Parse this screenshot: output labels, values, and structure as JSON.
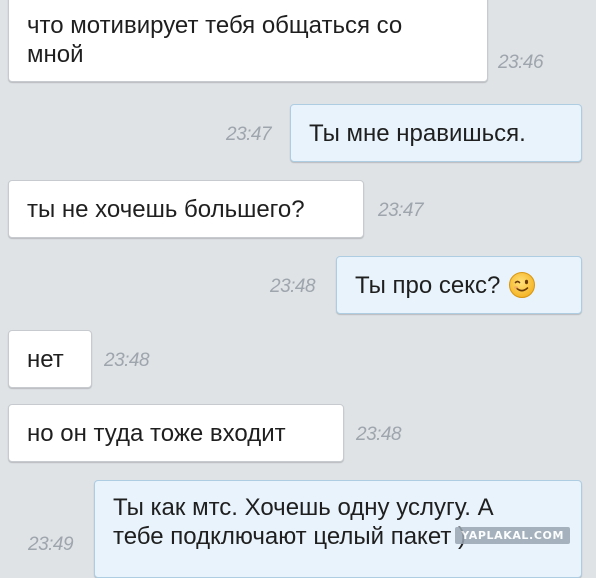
{
  "conversation": {
    "messages": [
      {
        "direction": "in",
        "text": "что мотивирует тебя общаться со\nмной",
        "time": "23:46"
      },
      {
        "direction": "out",
        "text": "Ты мне нравишься.",
        "time": "23:47"
      },
      {
        "direction": "in",
        "text": "ты не хочешь большего?",
        "time": "23:47"
      },
      {
        "direction": "out",
        "text": "Ты про секс?",
        "time": "23:48",
        "emoji": "winking-face-emoji"
      },
      {
        "direction": "in",
        "text": "нет",
        "time": "23:48"
      },
      {
        "direction": "in",
        "text": "но он туда тоже входит",
        "time": "23:48"
      },
      {
        "direction": "out",
        "text": "Ты как мтс. Хочешь одну услугу. А\nтебе подключают целый пакет )",
        "time": "23:49"
      }
    ]
  },
  "watermark": {
    "text": "YAPLAKAL.COM"
  },
  "colors": {
    "background": "#dfe3e6",
    "incoming_bubble": "#ffffff",
    "outgoing_bubble": "#e8f3fb",
    "timestamp": "#9ea5ad"
  }
}
